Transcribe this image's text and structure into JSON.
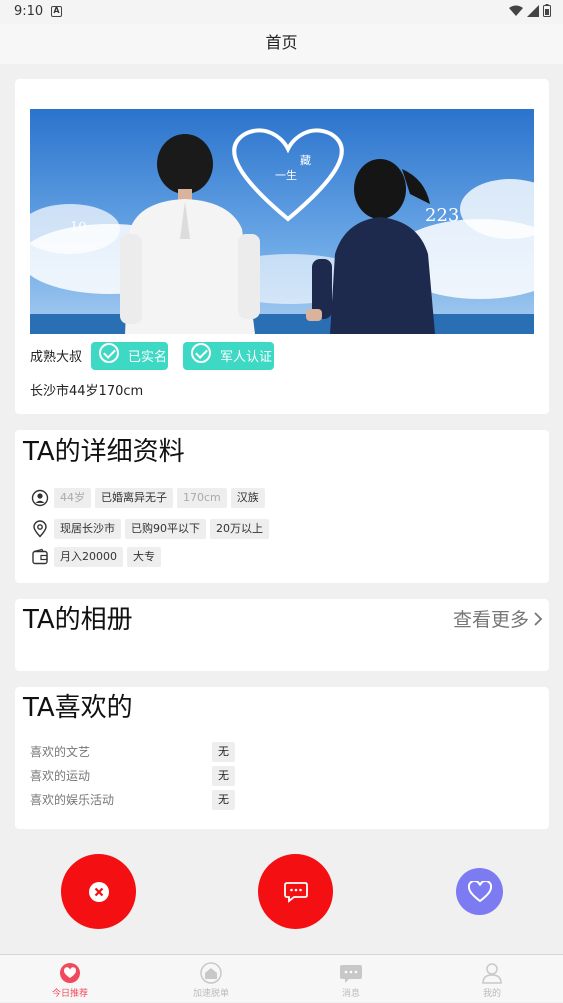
{
  "status_bar": {
    "time": "9:10",
    "notification_icon": "A"
  },
  "header": {
    "title": "首页"
  },
  "profile": {
    "nickname": "成熟大叔",
    "badges": [
      "已实名",
      "军人认证"
    ],
    "location_line": "长沙市44岁170cm",
    "photo_caption_text": [
      "一生",
      "藏",
      "10",
      "223"
    ]
  },
  "details": {
    "title": "TA的详细资料",
    "rows": [
      {
        "icon": "person-icon",
        "tags": [
          "44岁",
          "已婚离异无子",
          "170cm",
          "汉族"
        ]
      },
      {
        "icon": "location-pin-icon",
        "tags": [
          "现居长沙市",
          "已购90平以下",
          "20万以上"
        ]
      },
      {
        "icon": "wallet-icon",
        "tags": [
          "月入20000",
          "大专"
        ]
      }
    ]
  },
  "album": {
    "title": "TA的相册",
    "more_label": "查看更多"
  },
  "likes": {
    "title": "TA喜欢的",
    "items": [
      {
        "label": "喜欢的文艺",
        "value": "无"
      },
      {
        "label": "喜欢的运动",
        "value": "无"
      },
      {
        "label": "喜欢的娱乐活动",
        "value": "无"
      }
    ]
  },
  "actions": {
    "dismiss": "close-icon",
    "message": "chat-icon",
    "like": "heart-icon"
  },
  "tabbar": {
    "items": [
      {
        "label": "今日推荐",
        "icon": "heart-icon",
        "active": true
      },
      {
        "label": "加速脱单",
        "icon": "home-icon",
        "active": false
      },
      {
        "label": "消息",
        "icon": "message-icon",
        "active": false
      },
      {
        "label": "我的",
        "icon": "user-icon",
        "active": false
      }
    ]
  },
  "colors": {
    "badge": "#3ed9c4",
    "action_red": "#f40f12",
    "like_purple": "#7c7bf2",
    "tab_active": "#f04a5c"
  }
}
